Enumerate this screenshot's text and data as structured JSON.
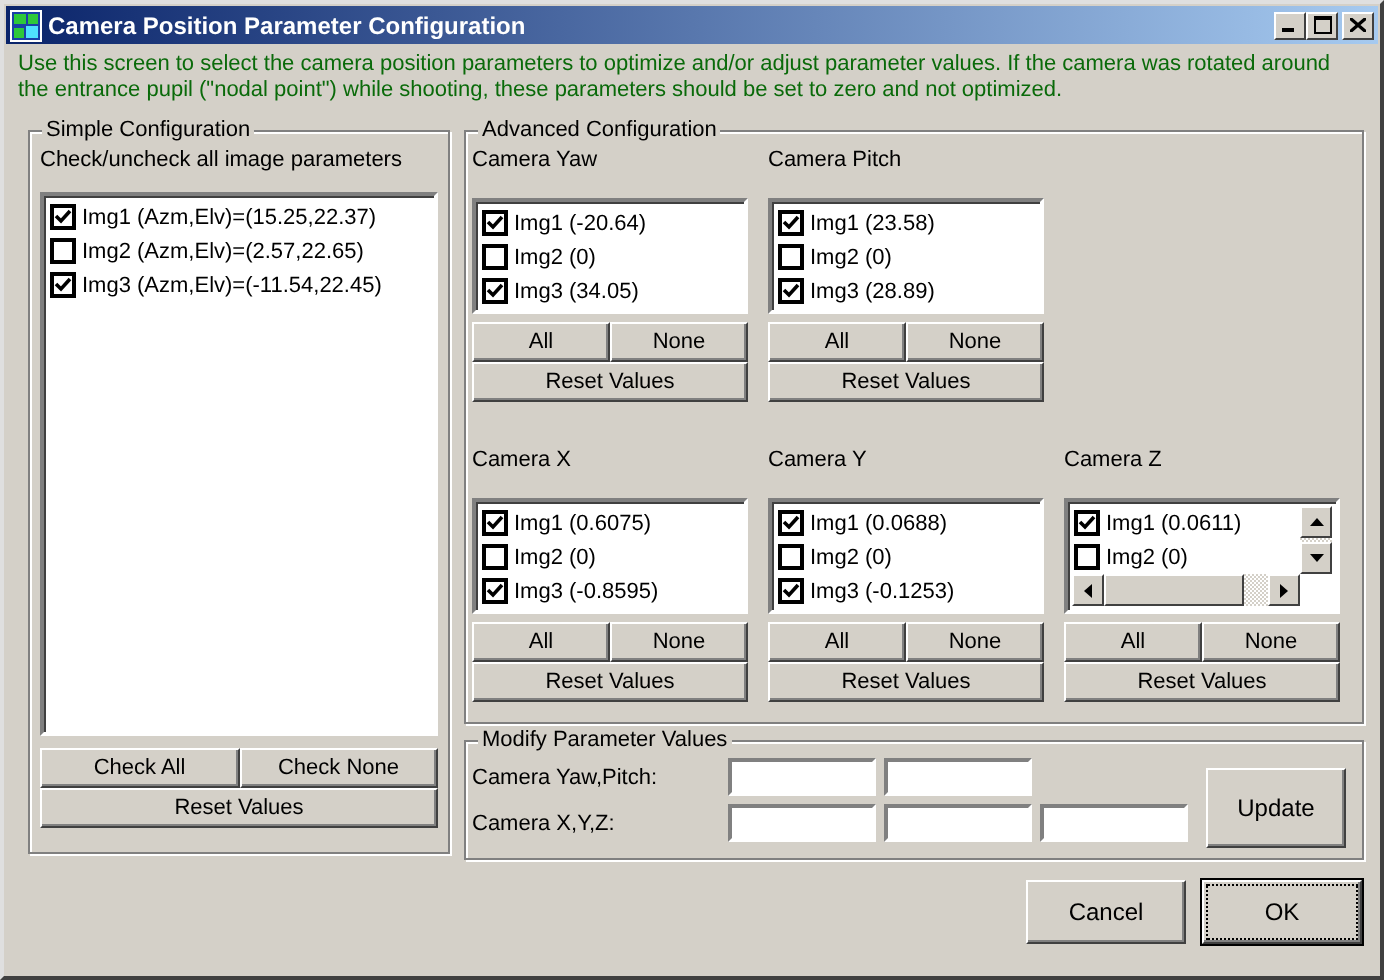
{
  "window": {
    "title": "Camera Position Parameter Configuration"
  },
  "description": "Use this screen to select the camera position parameters to optimize and/or adjust parameter values.  If the camera was rotated around the entrance pupil (\"nodal point\") while shooting, these parameters should be set to zero and not optimized.",
  "simple": {
    "title": "Simple Configuration",
    "hint": "Check/uncheck all image parameters",
    "items": [
      {
        "label": "Img1  (Azm,Elv)=(15.25,22.37)",
        "checked": true
      },
      {
        "label": "Img2  (Azm,Elv)=(2.57,22.65)",
        "checked": false
      },
      {
        "label": "Img3  (Azm,Elv)=(-11.54,22.45)",
        "checked": true
      }
    ],
    "buttons": [
      "Check All",
      "Check None"
    ],
    "reset": "Reset Values"
  },
  "advanced": {
    "title": "Advanced Configuration",
    "rows": [
      [
        {
          "label": "Camera Yaw",
          "scrollbars": false,
          "items": [
            {
              "label": "Img1  (-20.64)",
              "checked": true
            },
            {
              "label": "Img2  (0)",
              "checked": false
            },
            {
              "label": "Img3  (34.05)",
              "checked": true
            }
          ],
          "buttons": [
            "All",
            "None"
          ],
          "reset": "Reset Values"
        },
        {
          "label": "Camera Pitch",
          "scrollbars": false,
          "items": [
            {
              "label": "Img1  (23.58)",
              "checked": true
            },
            {
              "label": "Img2  (0)",
              "checked": false
            },
            {
              "label": "Img3  (28.89)",
              "checked": true
            }
          ],
          "buttons": [
            "All",
            "None"
          ],
          "reset": "Reset Values"
        }
      ],
      [
        {
          "label": "Camera X",
          "scrollbars": false,
          "items": [
            {
              "label": "Img1  (0.6075)",
              "checked": true
            },
            {
              "label": "Img2  (0)",
              "checked": false
            },
            {
              "label": "Img3  (-0.8595)",
              "checked": true
            }
          ],
          "buttons": [
            "All",
            "None"
          ],
          "reset": "Reset Values"
        },
        {
          "label": "Camera Y",
          "scrollbars": false,
          "items": [
            {
              "label": "Img1  (0.0688)",
              "checked": true
            },
            {
              "label": "Img2  (0)",
              "checked": false
            },
            {
              "label": "Img3  (-0.1253)",
              "checked": true
            }
          ],
          "buttons": [
            "All",
            "None"
          ],
          "reset": "Reset Values"
        },
        {
          "label": "Camera Z",
          "scrollbars": true,
          "items": [
            {
              "label": "Img1  (0.0611)",
              "checked": true
            },
            {
              "label": "Img2  (0)",
              "checked": false
            }
          ],
          "buttons": [
            "All",
            "None"
          ],
          "reset": "Reset Values"
        }
      ]
    ]
  },
  "modify": {
    "title": "Modify Parameter Values",
    "rows": [
      {
        "label": "Camera Yaw,Pitch:",
        "kind": "pair"
      },
      {
        "label": "Camera X,Y,Z:",
        "kind": "triple"
      }
    ],
    "update": "Update"
  },
  "buttons": [
    {
      "label": "Cancel",
      "default": false
    },
    {
      "label": "OK",
      "default": true
    }
  ]
}
